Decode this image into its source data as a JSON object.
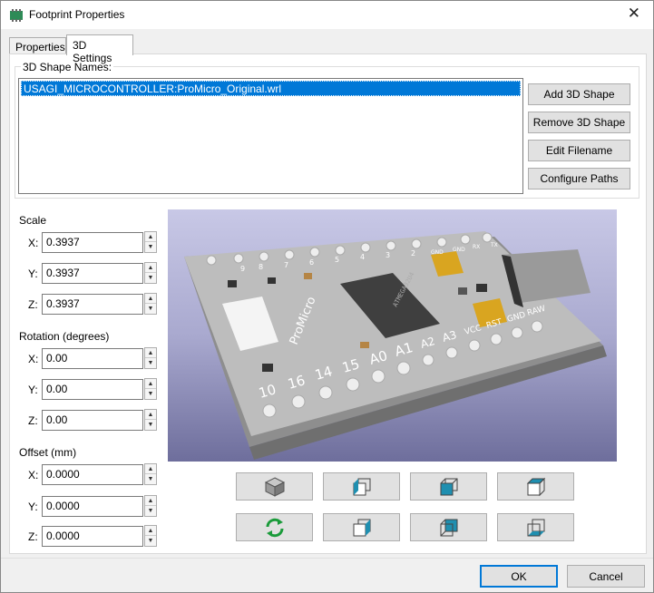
{
  "window": {
    "title": "Footprint Properties",
    "close_glyph": "✕",
    "icon": "pcb-footprint-icon"
  },
  "tabs": [
    {
      "label": "Properties",
      "active": false
    },
    {
      "label": "3D Settings",
      "active": true
    }
  ],
  "shapes": {
    "group_label": "3D Shape Names:",
    "items": [
      "USAGI_MICROCONTROLLER:ProMicro_Original.wrl"
    ],
    "selected_index": 0
  },
  "shape_buttons": {
    "add": "Add 3D Shape",
    "remove": "Remove 3D Shape",
    "edit": "Edit Filename",
    "configure": "Configure Paths"
  },
  "scale": {
    "label": "Scale",
    "x": {
      "label": "X:",
      "value": "0.3937"
    },
    "y": {
      "label": "Y:",
      "value": "0.3937"
    },
    "z": {
      "label": "Z:",
      "value": "0.3937"
    }
  },
  "rotation": {
    "label": "Rotation (degrees)",
    "x": {
      "label": "X:",
      "value": "0.00"
    },
    "y": {
      "label": "Y:",
      "value": "0.00"
    },
    "z": {
      "label": "Z:",
      "value": "0.00"
    }
  },
  "offset": {
    "label": "Offset (mm)",
    "x": {
      "label": "X:",
      "value": "0.0000"
    },
    "y": {
      "label": "Y:",
      "value": "0.0000"
    },
    "z": {
      "label": "Z:",
      "value": "0.0000"
    }
  },
  "preview": {
    "board_label": "ProMicro",
    "chip_label": "ATMEGA32U4",
    "pins_bottom": [
      "10",
      "16",
      "14",
      "15",
      "A0",
      "A1",
      "A2",
      "A3",
      "VCC",
      "RST",
      "GND",
      "RAW"
    ],
    "pins_top": [
      "9",
      "8",
      "7",
      "6",
      "5",
      "4",
      "3",
      "2",
      "GND",
      "GND",
      "RX",
      "TX"
    ],
    "colors": {
      "board": "#bdbdbd",
      "chip": "#3f3f3f",
      "capacitor": "#d9a520",
      "background_top": "#c8c8e6",
      "background_bottom": "#6e6e9c"
    }
  },
  "view_buttons": {
    "row1": [
      "iso-view-icon",
      "view-left-icon",
      "view-front-icon",
      "view-top-icon"
    ],
    "row2": [
      "reload-view-icon",
      "view-right-icon",
      "view-back-icon",
      "view-bottom-icon"
    ]
  },
  "dialog_buttons": {
    "ok": "OK",
    "cancel": "Cancel"
  }
}
